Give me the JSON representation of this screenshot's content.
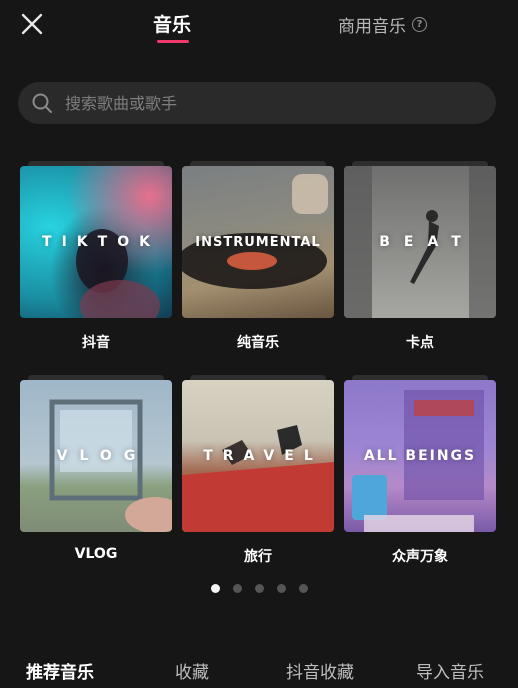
{
  "header": {
    "tab_music": "音乐",
    "tab_commercial": "商用音乐",
    "accent_color": "#f0386a"
  },
  "search": {
    "placeholder": "搜索歌曲或歌手"
  },
  "categories": [
    {
      "cover_text": "TIKTOK",
      "label": "抖音"
    },
    {
      "cover_text": "INSTRUMENTAL",
      "label": "纯音乐"
    },
    {
      "cover_text": "BEAT",
      "label": "卡点"
    },
    {
      "cover_text": "VLOG",
      "label": "VLOG"
    },
    {
      "cover_text": "TRAVEL",
      "label": "旅行"
    },
    {
      "cover_text": "ALL BEINGS",
      "label": "众声万象"
    }
  ],
  "pagination": {
    "current": 1,
    "total": 5
  },
  "bottom_tabs": [
    "推荐音乐",
    "收藏",
    "抖音收藏",
    "导入音乐"
  ],
  "icons": [
    "close-icon",
    "help-icon",
    "search-icon"
  ]
}
